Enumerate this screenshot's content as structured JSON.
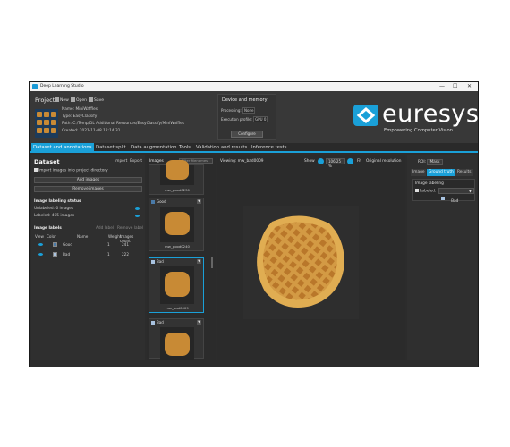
{
  "window": {
    "title": "Deep Learning Studio",
    "minimize": "—",
    "maximize": "☐",
    "close": "✕"
  },
  "project": {
    "label": "Project",
    "toolbar": {
      "new": "New",
      "open": "Open",
      "save": "Save"
    },
    "name": "Name: MiniWaffles",
    "type": "Type: EasyClassify",
    "path": "Path: C:/Temp/DL Additional Resources/EasyClassify/MiniWaffles",
    "created": "Created: 2021-11-08 12:14:31"
  },
  "device": {
    "title": "Device and memory",
    "processing_label": "Processing:",
    "processing_value": "None",
    "execution_label": "Execution profile:",
    "execution_value": "GPU 0",
    "configure": "Configure"
  },
  "logo": {
    "brand": "euresys",
    "tagline": "Empowering Computer Vision",
    "accent": "#1aa0d8"
  },
  "tabs": [
    {
      "label": "Dataset and annotations",
      "active": true
    },
    {
      "label": "Dataset split",
      "active": false
    },
    {
      "label": "Data augmentation",
      "active": false
    },
    {
      "label": "Tools",
      "active": false
    },
    {
      "label": "Validation and results",
      "active": false
    },
    {
      "label": "Inference tests",
      "active": false
    }
  ],
  "dataset": {
    "title": "Dataset",
    "import": "Import",
    "export": "Export",
    "import_into_project": "Import images into project directory",
    "add_images": "Add images",
    "remove_images": "Remove images",
    "labeling_status": "Image labeling status",
    "unlabeled": "Unlabeled: 0 images",
    "labeled": "Labeled:   465 images",
    "image_labels_title": "Image labels",
    "add_label": "Add label",
    "remove_label": "Remove label",
    "headers": {
      "view": "View",
      "color": "Color",
      "name": "Name",
      "weight": "Weight",
      "images": "Images count"
    },
    "labels": [
      {
        "name": "Good",
        "weight": "1",
        "count": "241",
        "color": "#4a7aa8"
      },
      {
        "name": "Bad",
        "weight": "1",
        "count": "222",
        "color": "#a9c3e0"
      }
    ]
  },
  "images_panel": {
    "title": "Images",
    "filter_placeholder": "Filter filenames",
    "cards": [
      {
        "label": "",
        "caption": "mw_good0230",
        "color": "#4a7aa8"
      },
      {
        "label": "Good",
        "caption": "mw_good0240",
        "color": "#4a7aa8"
      },
      {
        "label": "Bad",
        "caption": "mw_bad0009",
        "color": "#a9c3e0"
      },
      {
        "label": "Bad",
        "caption": "",
        "color": "#a9c3e0"
      }
    ]
  },
  "viewer": {
    "viewing_label": "Viewing:",
    "viewing_file": "mw_bad0009",
    "show": "Show",
    "zoom": "106.25 %",
    "fit": "Fit",
    "original": "Original resolution"
  },
  "right_panel": {
    "roi_label": "ROI:",
    "roi_value": "Mask",
    "tabs": [
      {
        "label": "Image",
        "active": false
      },
      {
        "label": "Ground truth",
        "active": true
      },
      {
        "label": "Results",
        "active": false
      }
    ],
    "labeling_title": "Image labeling",
    "labeled_check": "Labeled:",
    "label_value": "Bad"
  }
}
